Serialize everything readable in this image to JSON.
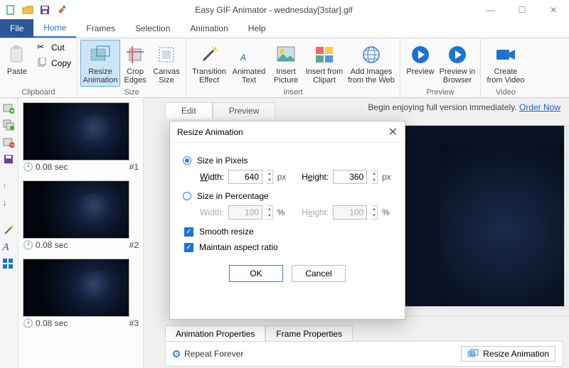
{
  "title": "Easy GIF Animator - wednesday[3star].gif",
  "file_tab": "File",
  "tabs": [
    "Home",
    "Frames",
    "Selection",
    "Animation",
    "Help"
  ],
  "active_tab": "Home",
  "clipboard": {
    "group": "Clipboard",
    "paste": "Paste",
    "cut": "Cut",
    "copy": "Copy"
  },
  "size": {
    "group": "Size",
    "resize": "Resize\nAnimation",
    "crop": "Crop\nEdges",
    "canvas": "Canvas\nSize"
  },
  "insert": {
    "group": "Insert",
    "transition": "Transition\nEffect",
    "animtext": "Animated\nText",
    "picture": "Insert\nPicture",
    "clipart": "Insert from\nClipart",
    "web": "Add Images\nfrom the Web"
  },
  "preview": {
    "group": "Preview",
    "preview": "Preview",
    "browser": "Preview in\nBrowser"
  },
  "video": {
    "group": "Video",
    "create": "Create\nfrom Video"
  },
  "frames": [
    {
      "duration": "0.08 sec",
      "idx": "#1"
    },
    {
      "duration": "0.08 sec",
      "idx": "#2"
    },
    {
      "duration": "0.08 sec",
      "idx": "#3"
    }
  ],
  "edit_tab": "Edit",
  "preview_tab": "Preview",
  "promo_text": "Begin enjoying full version immediately.",
  "promo_link": "Order Now",
  "bottom_tabs": {
    "anim": "Animation Properties",
    "frame": "Frame Properties"
  },
  "repeat": "Repeat Forever",
  "resize_anim_btn": "Resize Animation",
  "dialog": {
    "title": "Resize Animation",
    "size_px": "Size in Pixels",
    "size_pct": "Size in Percentage",
    "width": "Width:",
    "height": "Height:",
    "w_px": "640",
    "h_px": "360",
    "w_pct": "100",
    "h_pct": "100",
    "px": "px",
    "pct": "%",
    "smooth": "Smooth resize",
    "aspect": "Maintain aspect ratio",
    "ok": "OK",
    "cancel": "Cancel"
  }
}
